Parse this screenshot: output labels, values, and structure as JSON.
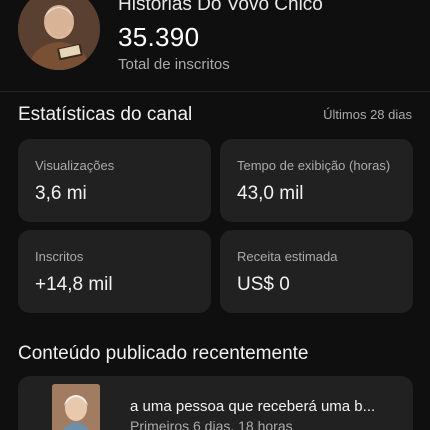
{
  "channel": {
    "name": "Histórias Do Vovô Chico",
    "subscriber_count": "35.390",
    "subscriber_label": "Total de inscritos"
  },
  "stats": {
    "title": "Estatísticas do canal",
    "period": "Últimos 28 dias",
    "cards": [
      {
        "label": "Visualizações",
        "value": "3,6 mi"
      },
      {
        "label": "Tempo de exibição (horas)",
        "value": "43,0 mil"
      },
      {
        "label": "Inscritos",
        "value": "+14,8 mil"
      },
      {
        "label": "Receita estimada",
        "value": "US$ 0"
      }
    ]
  },
  "recent": {
    "title": "Conteúdo publicado recentemente",
    "video": {
      "title": "a uma pessoa que receberá uma b...",
      "meta": "Primeiros 6 dias, 18 horas"
    }
  },
  "colors": {
    "background": "#0f0f0f",
    "card": "#212121",
    "text_primary": "#f1f1f1",
    "text_secondary": "#aaaaaa"
  }
}
